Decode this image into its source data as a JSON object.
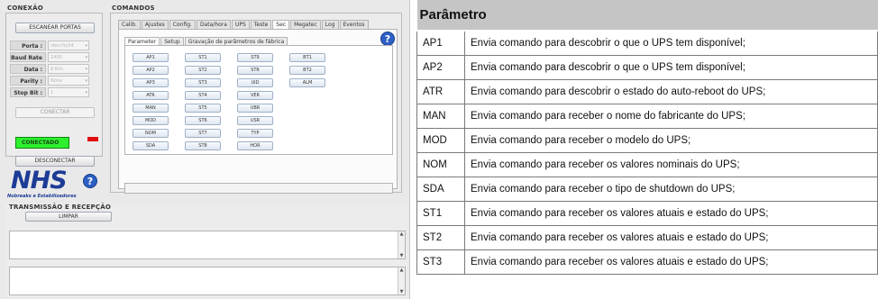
{
  "conexao": {
    "title": "CONEXÃO",
    "scan_button": "ESCANEAR PORTAS",
    "fields": [
      {
        "label": "Porta :",
        "value": "/dev/ttyS4"
      },
      {
        "label": "Baud Rate :",
        "value": "2400"
      },
      {
        "label": "Data :",
        "value": "8 Bits"
      },
      {
        "label": "Parity :",
        "value": "None"
      },
      {
        "label": "Stop Bit :",
        "value": "1"
      }
    ],
    "connect_button": "CONECTAR",
    "status": "CONECTADO",
    "status_color": "#2ef02e",
    "disconnect_button": "DESCONECTAR"
  },
  "logo": {
    "text": "NHS",
    "subtitle": "Nobreaks e Estabilizadores",
    "help_icon": "?"
  },
  "comandos": {
    "title": "COMANDOS",
    "tabs": [
      "Calib.",
      "Ajustes",
      "Config.",
      "Data/hora",
      "UPS",
      "Teste",
      "Sec",
      "Megatec",
      "Log",
      "Eventos"
    ],
    "active_tab": "Sec",
    "subtabs": [
      "Parameter",
      "Setup",
      "Gravação de parâmetros de fábrica"
    ],
    "active_subtab": "Parameter",
    "help_icon": "?",
    "columns": [
      [
        "AP1",
        "AP2",
        "AP3",
        "ATR",
        "MAN",
        "MOD",
        "NOM",
        "SDA"
      ],
      [
        "ST1",
        "ST2",
        "ST3",
        "ST4",
        "ST5",
        "ST6",
        "ST7",
        "ST8"
      ],
      [
        "ST9",
        "STR",
        "UID",
        "VER",
        "UBR",
        "USR",
        "TYP",
        "HOR"
      ],
      [
        "BT1",
        "BT2",
        "ALM"
      ]
    ]
  },
  "transmissao": {
    "title": "TRANSMISSÃO E RECEPÇÃO",
    "clear_button": "LIMPAR"
  },
  "parameters": {
    "header": "Parâmetro",
    "rows": [
      {
        "code": "AP1",
        "description": "Envia comando para descobrir o que o UPS tem disponível;"
      },
      {
        "code": "AP2",
        "description": "Envia comando para descobrir o que o UPS tem disponível;"
      },
      {
        "code": "ATR",
        "description": "Envia comando para descobrir o estado do auto-reboot do UPS;"
      },
      {
        "code": "MAN",
        "description": "Envia comando para receber o nome do fabricante do UPS;"
      },
      {
        "code": "MOD",
        "description": "Envia comando para receber o modelo do UPS;"
      },
      {
        "code": "NOM",
        "description": "Envia comando para receber os valores nominais do UPS;"
      },
      {
        "code": "SDA",
        "description": "Envia comando para receber o tipo de shutdown do UPS;"
      },
      {
        "code": "ST1",
        "description": "Envia comando para receber os valores atuais e estado do UPS;"
      },
      {
        "code": "ST2",
        "description": "Envia comando para receber os valores atuais e estado do UPS;"
      },
      {
        "code": "ST3",
        "description": "Envia comando para receber os valores atuais e estado do UPS;"
      }
    ]
  }
}
